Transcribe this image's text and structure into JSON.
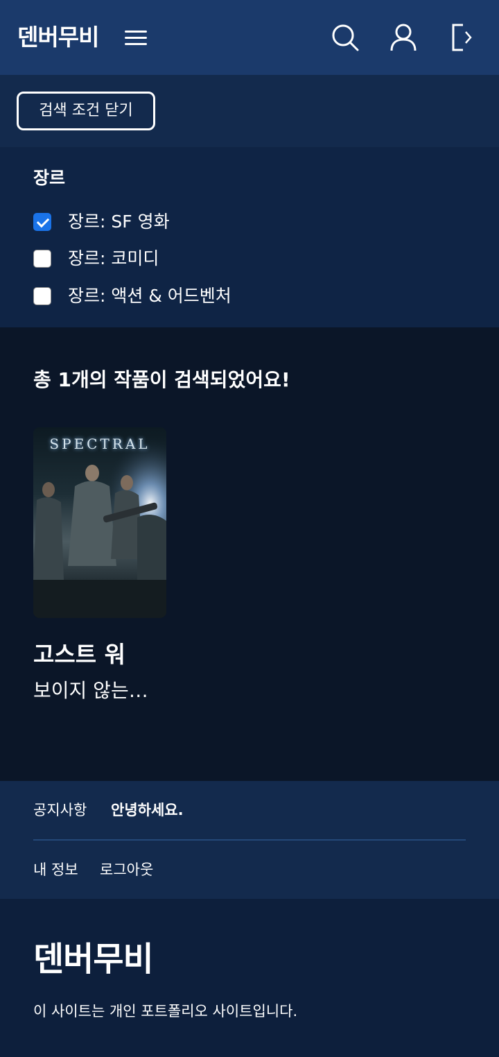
{
  "header": {
    "logo": "덴버무비",
    "icons": [
      "hamburger-menu-icon",
      "search-icon",
      "user-icon",
      "logout-icon"
    ]
  },
  "filter": {
    "close_label": "검색 조건 닫기"
  },
  "genre": {
    "title": "장르",
    "options": [
      {
        "label": "장르: SF 영화",
        "checked": true
      },
      {
        "label": "장르: 코미디",
        "checked": false
      },
      {
        "label": "장르: 액션 & 어드벤처",
        "checked": false
      }
    ]
  },
  "results": {
    "summary": "총 1개의 작품이 검색되었어요!",
    "items": [
      {
        "poster_text": "SPECTRAL",
        "title": "고스트 워",
        "subtitle": "보이지 않는…"
      }
    ]
  },
  "footer": {
    "notice_label": "공지사항",
    "notice_text": "안녕하세요.",
    "links": [
      "내 정보",
      "로그아웃"
    ],
    "logo": "덴버무비",
    "description": "이 사이트는 개인 포트폴리오 사이트입니다."
  },
  "colors": {
    "header_bg": "#1b3a6b",
    "filterbar_bg": "#132a4d",
    "panel_bg": "#0f2445",
    "page_bg": "#0b1628",
    "checkbox_accent": "#1a73e8"
  }
}
